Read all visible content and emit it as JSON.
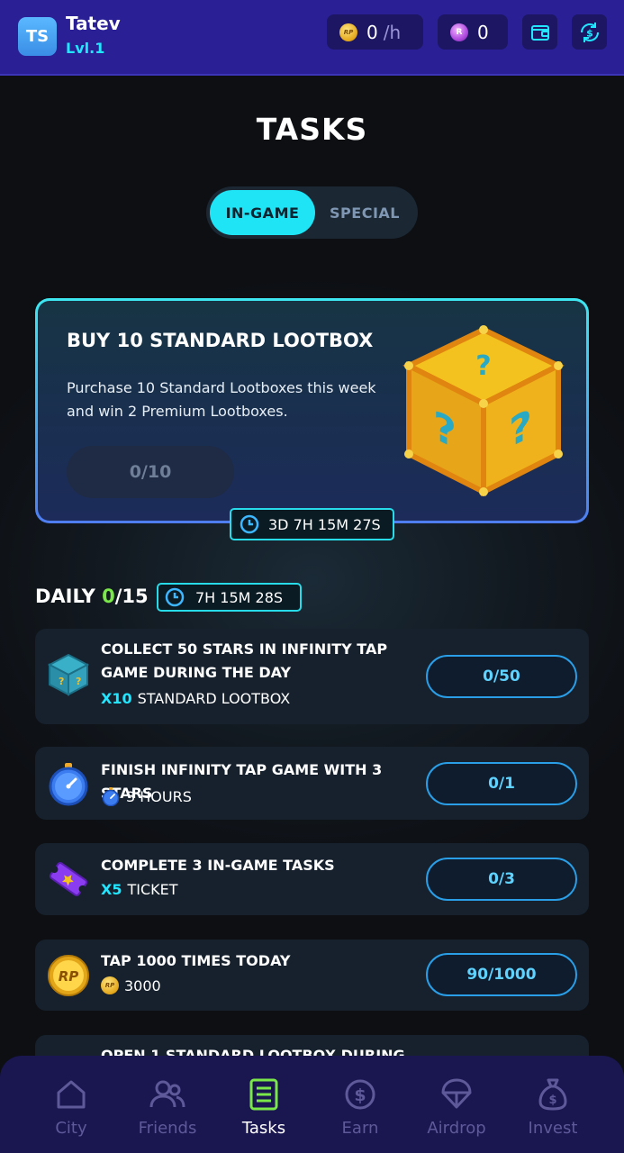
{
  "header": {
    "avatar_initials": "TS",
    "username": "Tatev",
    "level": "Lvl.1",
    "rp_rate_value": "0",
    "rp_rate_unit": "/h",
    "gems_value": "0"
  },
  "page": {
    "title": "TASKS",
    "tabs": [
      {
        "label": "IN-GAME",
        "active": true
      },
      {
        "label": "SPECIAL",
        "active": false
      }
    ]
  },
  "featured": {
    "title": "BUY 10 STANDARD LOOTBOX",
    "description": "Purchase 10 Standard Lootboxes this week and win 2 Premium Lootboxes.",
    "progress": "0/10",
    "timer": "3D 7H 15M 27S"
  },
  "daily": {
    "label": "DAILY",
    "done": "0",
    "total": "/15",
    "timer": "7H 15M 28S",
    "tasks": [
      {
        "title": "COLLECT 50 STARS IN INFINITY TAP GAME DURING THE DAY",
        "reward_mult": "X10",
        "reward_label": "STANDARD LOOTBOX",
        "progress": "0/50",
        "icon": "lootbox-icon"
      },
      {
        "title": "FINISH INFINITY TAP GAME WITH 3 STARS",
        "reward_mult": "",
        "reward_label": "3 HOURS",
        "progress": "0/1",
        "icon": "stopwatch-icon"
      },
      {
        "title": "COMPLETE 3 IN-GAME TASKS",
        "reward_mult": "X5",
        "reward_label": "TICKET",
        "progress": "0/3",
        "icon": "ticket-icon"
      },
      {
        "title": "TAP 1000 TIMES TODAY",
        "reward_mult": "",
        "reward_label": "3000",
        "progress": "90/1000",
        "icon": "rp-coin-icon"
      },
      {
        "title": "OPEN 1 STANDARD LOOTBOX DURING",
        "icon": "lootbox-icon"
      }
    ]
  },
  "nav": [
    {
      "label": "City",
      "icon": "home-icon",
      "active": false
    },
    {
      "label": "Friends",
      "icon": "friends-icon",
      "active": false
    },
    {
      "label": "Tasks",
      "icon": "tasks-icon",
      "active": true
    },
    {
      "label": "Earn",
      "icon": "dollar-icon",
      "active": false
    },
    {
      "label": "Airdrop",
      "icon": "parachute-icon",
      "active": false
    },
    {
      "label": "Invest",
      "icon": "money-bag-icon",
      "active": false
    }
  ],
  "colors": {
    "header_bg": "#2a1f94",
    "accent_cyan": "#1fe4f5",
    "daily_count_green": "#7be84a",
    "nav_bg": "#1a1650"
  }
}
